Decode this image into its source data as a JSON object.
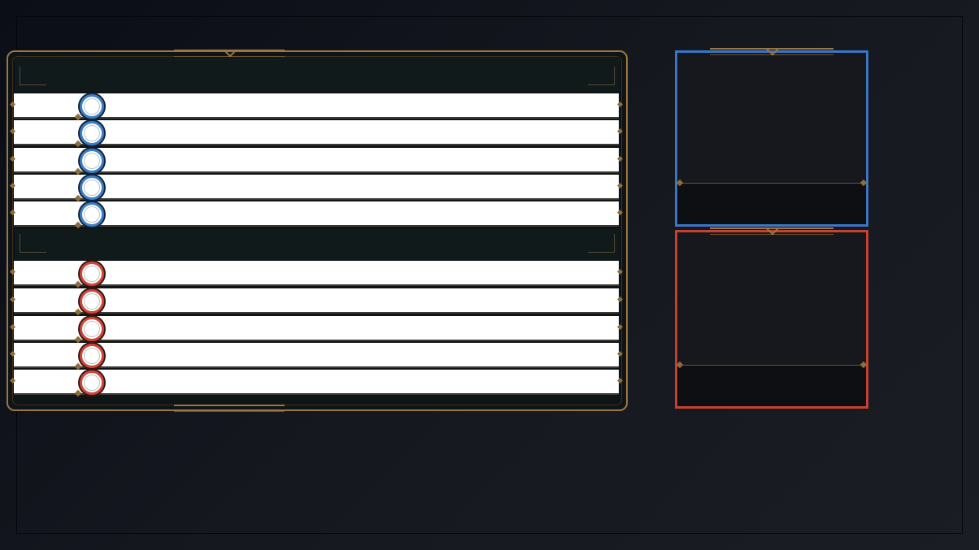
{
  "colors": {
    "blue_team": "#3a76c4",
    "red_team": "#c8402f",
    "gold_frame": "#9a7740",
    "row_fill": "#ffffff",
    "panel_dark": "#0f1416"
  },
  "icons": {
    "champion_slot": "ring-icon",
    "row_marker": "diamond-icon"
  },
  "blue_team": {
    "players": [
      {
        "name": ""
      },
      {
        "name": ""
      },
      {
        "name": ""
      },
      {
        "name": ""
      },
      {
        "name": ""
      }
    ]
  },
  "red_team": {
    "players": [
      {
        "name": ""
      },
      {
        "name": ""
      },
      {
        "name": ""
      },
      {
        "name": ""
      },
      {
        "name": ""
      }
    ]
  },
  "blue_camera": {
    "caption": ""
  },
  "red_camera": {
    "caption": ""
  }
}
